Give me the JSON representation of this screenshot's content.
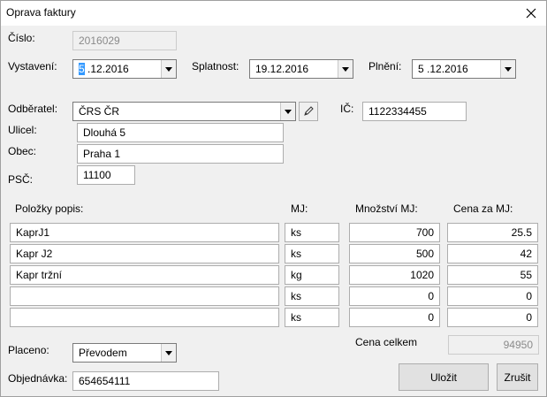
{
  "window": {
    "title": "Oprava faktury"
  },
  "header": {
    "cislo_label": "Číslo:",
    "cislo_value": "2016029",
    "vystaveni_label": "Vystavení:",
    "vystaveni_day": "5",
    "vystaveni_rest": " .12.2016",
    "splatnost_label": "Splatnost:",
    "splatnost_value": "19.12.2016",
    "plneni_label": "Plnění:",
    "plneni_value": "5 .12.2016"
  },
  "customer": {
    "odberatel_label": "Odběratel:",
    "odberatel_value": "ČRS ČR",
    "ic_label": "IČ:",
    "ic_value": "1122334455",
    "ulice_label": "Ulicel:",
    "ulice_value": "Dlouhá 5",
    "obec_label": "Obec:",
    "obec_value": "Praha 1",
    "psc_label": "PSČ:",
    "psc_value": "11100"
  },
  "items": {
    "col_popis": "Položky popis:",
    "col_mj": "MJ:",
    "col_mnozstvi": "Množství MJ:",
    "col_cena": "Cena za MJ:",
    "rows": [
      {
        "popis": "KaprJ1",
        "mj": "ks",
        "mnozstvi": "700",
        "cena": "25.5"
      },
      {
        "popis": "Kapr J2",
        "mj": "ks",
        "mnozstvi": "500",
        "cena": "42"
      },
      {
        "popis": "Kapr tržní",
        "mj": "kg",
        "mnozstvi": "1020",
        "cena": "55"
      },
      {
        "popis": "",
        "mj": "ks",
        "mnozstvi": "0",
        "cena": "0"
      },
      {
        "popis": "",
        "mj": "ks",
        "mnozstvi": "0",
        "cena": "0"
      }
    ]
  },
  "footer": {
    "placeno_label": "Placeno:",
    "placeno_value": "Převodem",
    "cena_celkem_label": "Cena celkem",
    "cena_celkem_value": "94950",
    "objednavka_label": "Objednávka:",
    "objednavka_value": "654654111",
    "ulozit_label": "Uložit",
    "zrusit_label": "Zrušit"
  }
}
